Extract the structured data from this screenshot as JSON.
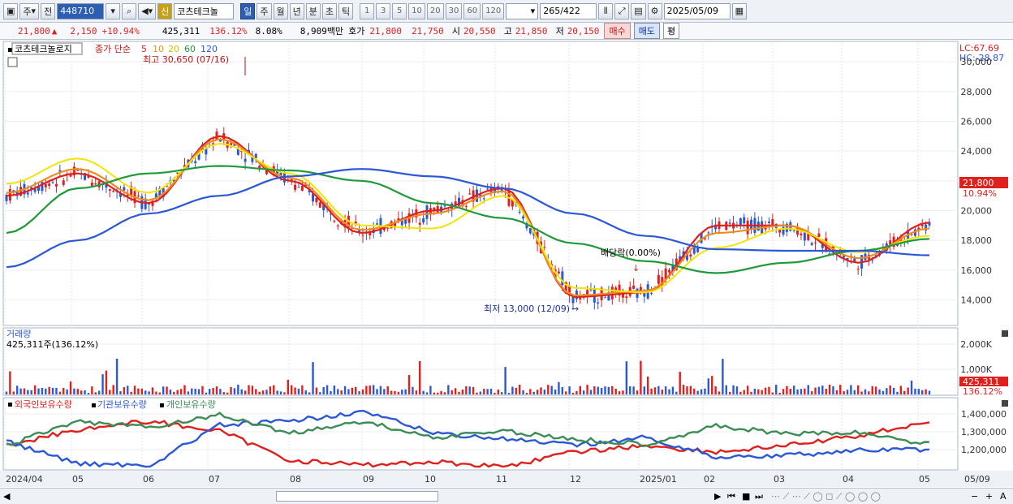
{
  "toolbar": {
    "period_type": "주",
    "prev_label": "전",
    "stock_code": "448710",
    "stock_name": "코츠테크놀",
    "new_badge": "신",
    "periods": [
      "일",
      "주",
      "월",
      "년",
      "분",
      "초",
      "틱"
    ],
    "active_period": "일",
    "intervals": [
      "1",
      "3",
      "5",
      "10",
      "20",
      "30",
      "60",
      "120"
    ],
    "count": "265",
    "total": "/422",
    "date": "2025/05/09"
  },
  "info": {
    "price": "21,800",
    "up_arrow": "▲",
    "change": "2,150",
    "change_rate": "+10.94%",
    "volume": "425,311",
    "volume_ratio": "136.12%",
    "turnover_rate": "8.08%",
    "amount": "8,909백만",
    "quote_label": "호가",
    "ask": "21,800",
    "bid": "21,750",
    "open_label": "시",
    "open": "20,550",
    "high_label": "고",
    "high": "21,850",
    "low_label": "저",
    "low": "20,150",
    "buy_label": "매수",
    "sell_label": "매도",
    "avg_label": "평"
  },
  "price_panel": {
    "name_label": "코츠테크놀로지",
    "legend_prefix": "종가 단순",
    "ma_labels": [
      "5",
      "10",
      "20",
      "60",
      "120"
    ],
    "ma_colors": [
      "#e0201d",
      "#f08c1c",
      "#f5e400",
      "#1f9a38",
      "#2b58d6"
    ],
    "max_label": "최고 30,650 (07/16)",
    "min_label": "최저 13,000 (12/09)",
    "dividend_label": "배당락(0.00%)",
    "lc_label": "LC:67.69",
    "hc_label": "HC:-28.87",
    "yticks": [
      "30,000",
      "28,000",
      "26,000",
      "24,000",
      "22,000",
      "20,000",
      "18,000",
      "16,000",
      "14,000"
    ],
    "current_price_tag": "21,800",
    "current_rate_tag": "10.94%"
  },
  "volume_panel": {
    "title": "거래량",
    "value_label": "425,311주(136.12%)",
    "yticks": [
      "2,000K",
      "1,000K"
    ],
    "current_tag": "425,311",
    "current_rate_tag": "136.12%"
  },
  "holding_panel": {
    "series_labels": [
      "외국인보유수량",
      "기관보유수량",
      "개인보유수량"
    ],
    "series_colors": [
      "#e0201d",
      "#2b58d6",
      "#3c8c55"
    ],
    "yticks": [
      "1,400,000",
      "1,300,000",
      "1,200,000"
    ]
  },
  "x_axis": {
    "labels": [
      "2024/04",
      "05",
      "06",
      "07",
      "08",
      "09",
      "10",
      "11",
      "12",
      "2025/01",
      "02",
      "03",
      "04",
      "05"
    ],
    "right_label": "05/09"
  },
  "chart_data": {
    "type": "line",
    "x": [
      "2024/04",
      "05",
      "06",
      "07",
      "08",
      "09",
      "10",
      "11",
      "12",
      "2025/01",
      "02",
      "03",
      "04",
      "05"
    ],
    "series": [
      {
        "name": "5",
        "values": [
          21000,
          22500,
          20500,
          25000,
          22000,
          18500,
          20000,
          21500,
          14200,
          14500,
          19000,
          19000,
          16500,
          19200
        ]
      },
      {
        "name": "10",
        "values": [
          21200,
          22800,
          20700,
          24800,
          22200,
          18700,
          19800,
          21300,
          14300,
          14600,
          18500,
          19000,
          16800,
          18800
        ]
      },
      {
        "name": "20",
        "values": [
          21800,
          23500,
          21200,
          24500,
          22500,
          19000,
          18800,
          21000,
          14800,
          14500,
          17500,
          18800,
          17200,
          18300
        ]
      },
      {
        "name": "60",
        "values": [
          18500,
          21500,
          22500,
          23000,
          22700,
          22000,
          20500,
          19500,
          17800,
          16600,
          15800,
          16500,
          17300,
          18100
        ]
      },
      {
        "name": "120",
        "values": [
          16200,
          18000,
          19800,
          21000,
          22300,
          22800,
          22300,
          21500,
          19800,
          18300,
          17400,
          17300,
          17300,
          17000
        ]
      }
    ],
    "ylim": [
      12500,
      30500
    ]
  }
}
